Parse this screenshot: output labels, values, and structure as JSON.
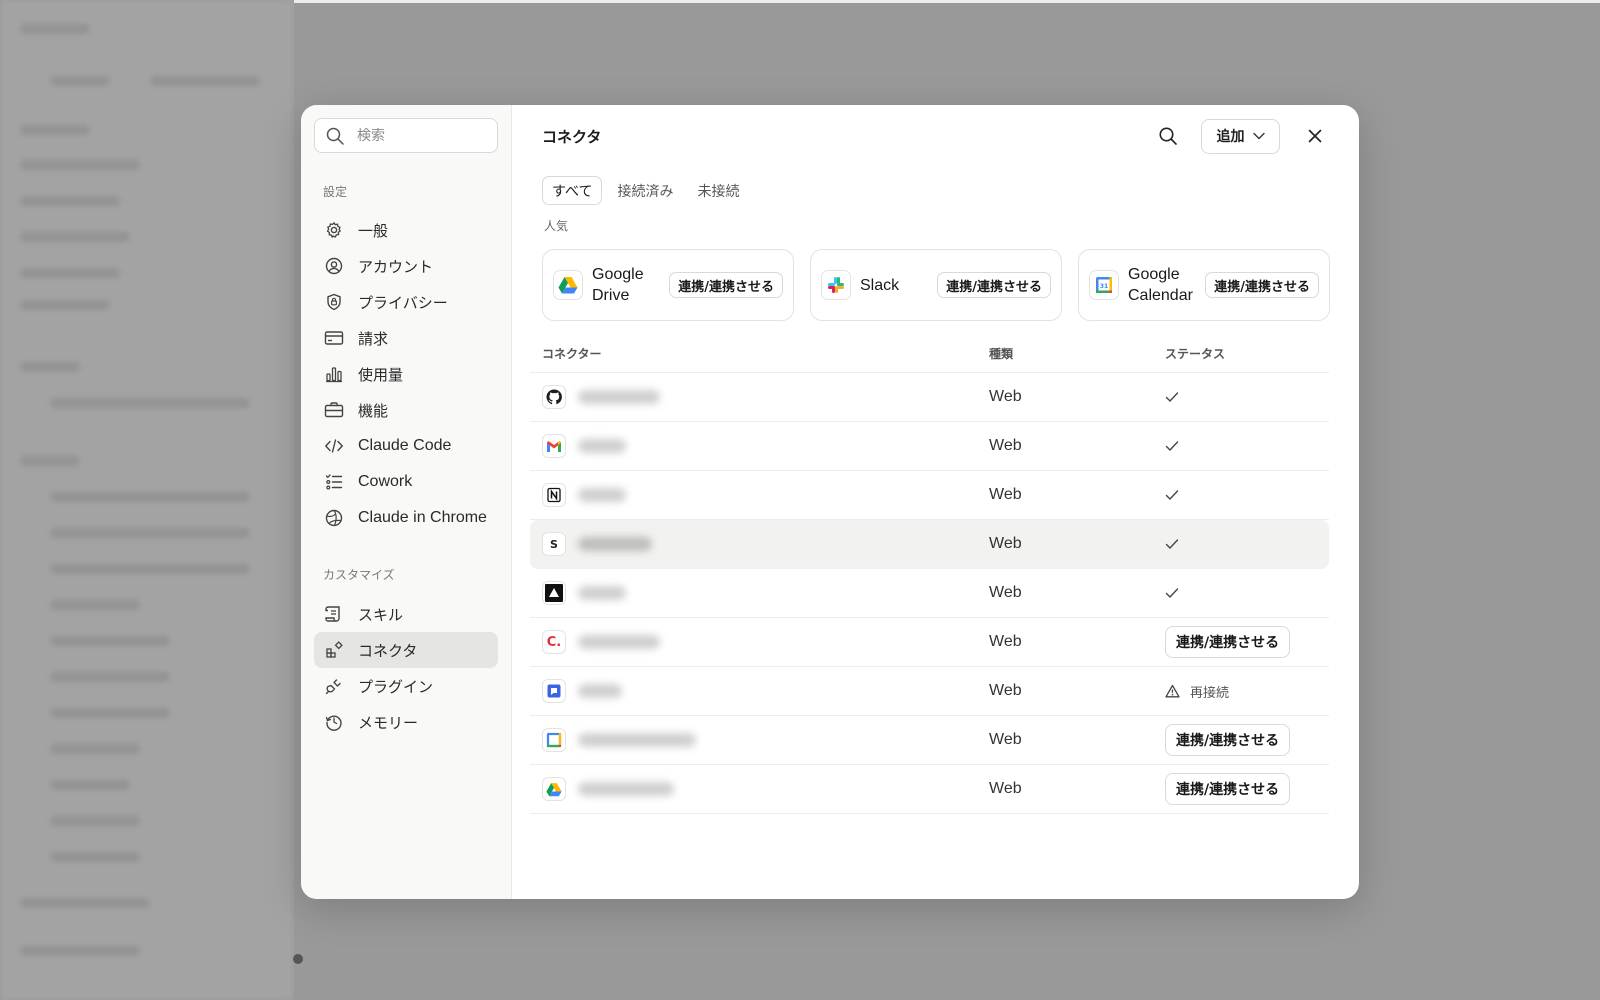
{
  "sidebar": {
    "search_placeholder": "検索",
    "settings_label": "設定",
    "settings_items": [
      {
        "label": "一般",
        "icon": "gear-icon"
      },
      {
        "label": "アカウント",
        "icon": "user-circle-icon"
      },
      {
        "label": "プライバシー",
        "icon": "shield-icon"
      },
      {
        "label": "請求",
        "icon": "credit-card-icon"
      },
      {
        "label": "使用量",
        "icon": "bar-chart-icon"
      },
      {
        "label": "機能",
        "icon": "briefcase-icon"
      },
      {
        "label": "Claude Code",
        "icon": "code-icon"
      },
      {
        "label": "Cowork",
        "icon": "checklist-icon"
      },
      {
        "label": "Claude in Chrome",
        "icon": "globe-icon"
      }
    ],
    "customize_label": "カスタマイズ",
    "customize_items": [
      {
        "label": "スキル",
        "icon": "scroll-icon"
      },
      {
        "label": "コネクタ",
        "icon": "connector-icon",
        "active": true
      },
      {
        "label": "プラグイン",
        "icon": "plug-icon"
      },
      {
        "label": "メモリー",
        "icon": "history-icon"
      }
    ]
  },
  "main": {
    "title": "コネクタ",
    "add_label": "追加",
    "tabs": [
      "すべて",
      "接続済み",
      "未接続"
    ],
    "active_tab": "すべて",
    "popular_label": "人気",
    "popular_cards": [
      {
        "name": "Google Drive",
        "button": "連携/連携させる",
        "icon": "google-drive-icon"
      },
      {
        "name": "Slack",
        "button": "連携/連携させる",
        "icon": "slack-icon"
      },
      {
        "name": "Google Calendar",
        "button": "連携/連携させる",
        "icon": "google-calendar-icon"
      }
    ],
    "table": {
      "headers": [
        "コネクター",
        "種類",
        "ステータス"
      ],
      "rows": [
        {
          "icon": "github-icon",
          "type": "Web",
          "status": "connected"
        },
        {
          "icon": "gmail-icon",
          "type": "Web",
          "status": "connected"
        },
        {
          "icon": "notion-icon",
          "type": "Web",
          "status": "connected"
        },
        {
          "icon": "s-letter-icon",
          "type": "Web",
          "status": "connected",
          "highlighted": true
        },
        {
          "icon": "vercel-icon",
          "type": "Web",
          "status": "connected"
        },
        {
          "icon": "c-letter-icon",
          "type": "Web",
          "status": "connect",
          "button": "連携/連携させる"
        },
        {
          "icon": "chat-icon",
          "type": "Web",
          "status": "reconnect",
          "reconnect_label": "再接続"
        },
        {
          "icon": "google-calendar-icon",
          "type": "Web",
          "status": "connect",
          "button": "連携/連携させる"
        },
        {
          "icon": "google-drive-icon",
          "type": "Web",
          "status": "connect",
          "button": "連携/連携させる"
        }
      ]
    }
  },
  "colors": {
    "overlay": "#9a9a9a",
    "modal": "#ffffff",
    "sidebar": "#f9f9f8",
    "active_nav": "#e5e5e2"
  }
}
